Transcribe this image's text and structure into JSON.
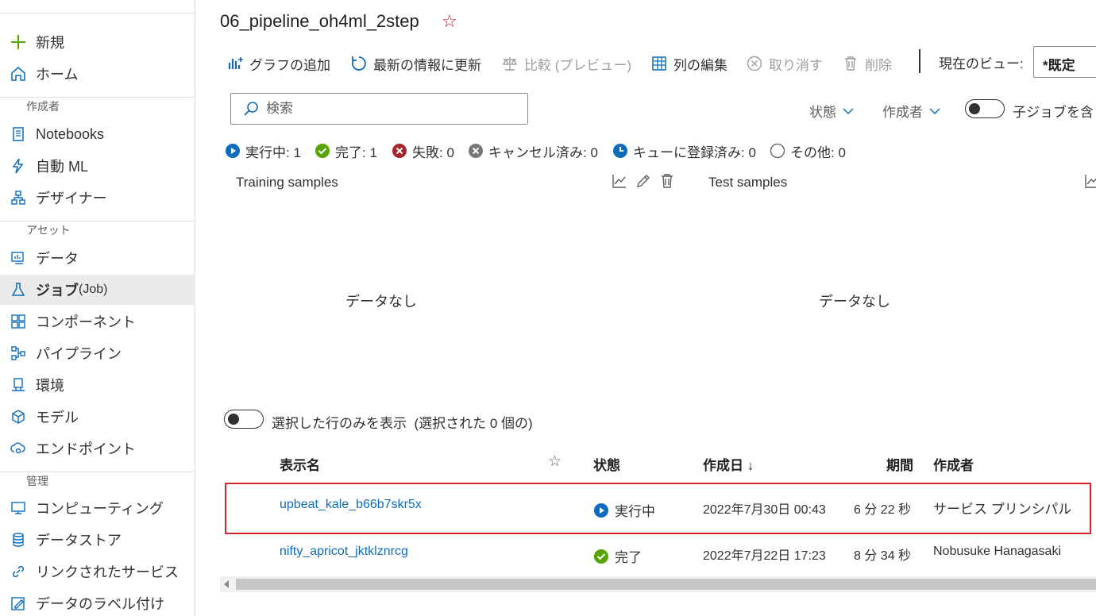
{
  "sidebar": {
    "new_label": "新規",
    "home_label": "ホーム",
    "sections": {
      "author": "作成者",
      "assets": "アセット",
      "manage": "管理"
    },
    "author_items": [
      {
        "label": "Notebooks",
        "icon": "notebook-icon"
      },
      {
        "label": "自動 ML",
        "icon": "automl-icon"
      },
      {
        "label": "デザイナー",
        "icon": "designer-icon"
      }
    ],
    "asset_items": [
      {
        "label": "データ",
        "icon": "data-icon"
      },
      {
        "label": "ジョブ",
        "sublabel": " (Job)",
        "icon": "jobs-icon",
        "active": true
      },
      {
        "label": "コンポーネント",
        "icon": "components-icon"
      },
      {
        "label": "パイプライン",
        "icon": "pipelines-icon"
      },
      {
        "label": "環境",
        "icon": "environments-icon"
      },
      {
        "label": "モデル",
        "icon": "models-icon"
      },
      {
        "label": "エンドポイント",
        "icon": "endpoints-icon"
      }
    ],
    "manage_items": [
      {
        "label": "コンピューティング",
        "icon": "compute-icon"
      },
      {
        "label": "データストア",
        "icon": "datastores-icon"
      },
      {
        "label": "リンクされたサービス",
        "icon": "linked-services-icon"
      },
      {
        "label": "データのラベル付け",
        "icon": "data-labeling-icon"
      }
    ]
  },
  "header": {
    "title": "06_pipeline_oh4ml_2step",
    "favorite_icon": "star-icon"
  },
  "toolbar": {
    "add_chart": "グラフの追加",
    "refresh": "最新の情報に更新",
    "compare": "比較 (プレビュー)",
    "edit_columns": "列の編集",
    "cancel": "取り消す",
    "delete": "削除",
    "current_view_label": "現在のビュー:",
    "current_view_value": "*既定"
  },
  "filters": {
    "search_placeholder": "検索",
    "status": "状態",
    "created_by": "作成者",
    "child_jobs_label": "子ジョブを含"
  },
  "status_summary": [
    {
      "label": "実行中: 1",
      "icon": "running-icon",
      "color": "#0f6cbd"
    },
    {
      "label": "完了: 1",
      "icon": "completed-icon",
      "color": "#57a300"
    },
    {
      "label": "失敗: 0",
      "icon": "failed-icon",
      "color": "#a4262c"
    },
    {
      "label": "キャンセル済み: 0",
      "icon": "canceled-icon",
      "color": "#797775"
    },
    {
      "label": "キューに登録済み: 0",
      "icon": "queued-icon",
      "color": "#0f6cbd"
    },
    {
      "label": "その他: 0",
      "icon": "other-icon",
      "color": "#605e5c"
    }
  ],
  "charts": [
    {
      "title": "Training samples",
      "empty_text": "データなし"
    },
    {
      "title": "Test samples",
      "empty_text": "データなし"
    }
  ],
  "selection": {
    "label": "選択した行のみを表示",
    "count_text": "(選択された 0 個の)"
  },
  "table": {
    "columns": {
      "name": "表示名",
      "status": "状態",
      "created": "作成日 ↓",
      "duration": "期間",
      "author": "作成者"
    },
    "rows": [
      {
        "name": "upbeat_kale_b66b7skr5x",
        "status": "実行中",
        "status_icon": "running-icon",
        "created": "2022年7月30日 00:43",
        "duration": "6 分 22 秒",
        "author": "サービス プリンシパル",
        "highlighted": true
      },
      {
        "name": "nifty_apricot_jktklznrcg",
        "status": "完了",
        "status_icon": "completed-icon",
        "created": "2022年7月22日 17:23",
        "duration": "8 分 34 秒",
        "author": "Nobusuke Hanagasaki",
        "highlighted": false
      }
    ]
  },
  "colors": {
    "accent": "#0f6cbd",
    "success": "#57a300",
    "danger": "#a4262c",
    "highlight_border": "#d8232a"
  }
}
